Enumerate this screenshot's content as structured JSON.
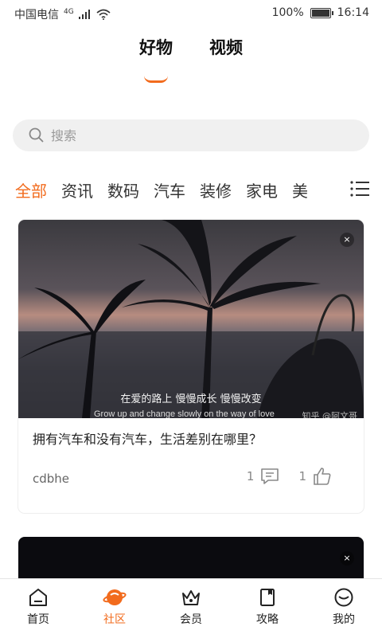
{
  "status_bar": {
    "carrier": "中国电信",
    "network": "4G",
    "battery": "100%",
    "time": "16:14"
  },
  "top_tabs": [
    {
      "label": "好物",
      "active": true
    },
    {
      "label": "视频",
      "active": false
    }
  ],
  "search": {
    "placeholder": "搜索"
  },
  "categories": [
    "全部",
    "资讯",
    "数码",
    "汽车",
    "装修",
    "家电",
    "美"
  ],
  "active_category": "全部",
  "feed": [
    {
      "caption_cn": "在爱的路上 慢慢成长 慢慢改变",
      "caption_en": "Grow up and change slowly on the way of love",
      "watermark": "知乎 @阿文哥",
      "title": "拥有汽车和没有汽车，生活差别在哪里？",
      "author": "cdbhe",
      "comments": "1",
      "likes": "1",
      "close_label": "×"
    },
    {
      "close_label": "×"
    }
  ],
  "bottom_nav": [
    {
      "label": "首页",
      "icon": "home-icon"
    },
    {
      "label": "社区",
      "icon": "community-icon",
      "active": true
    },
    {
      "label": "会员",
      "icon": "crown-icon"
    },
    {
      "label": "攻略",
      "icon": "guide-icon"
    },
    {
      "label": "我的",
      "icon": "profile-icon"
    }
  ],
  "colors": {
    "accent": "#f26b1d"
  }
}
